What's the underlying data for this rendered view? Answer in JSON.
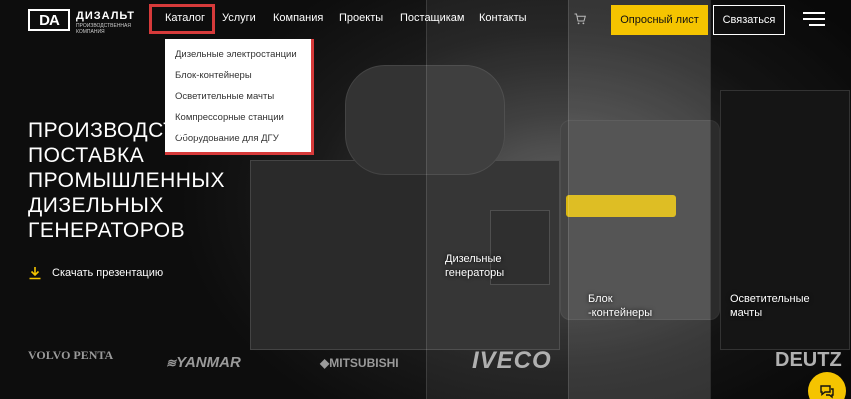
{
  "header": {
    "logo_mark": "DA",
    "logo_name": "ДИЗАЛЬТ",
    "logo_sub": "ПРОИЗВОДСТВЕННАЯ КОМПАНИЯ",
    "nav": [
      "Каталог",
      "Услуги",
      "Компания",
      "Проекты",
      "Постащикам",
      "Контакты"
    ],
    "survey_button": "Опросный лист",
    "contact_button": "Связаться"
  },
  "dropdown": {
    "items": [
      "Дизельные электростанции",
      "Блок-контейнеры",
      "Осветительные мачты",
      "Компрессорные станции",
      "Оборудование для ДГУ"
    ]
  },
  "hero": {
    "title": "Производство и поставка промышленных дизельных генераторов",
    "download_label": "Скачать презентацию"
  },
  "panels": {
    "gen": "Дизельные генераторы",
    "block": "Блок -контейнеры",
    "light": "Осветительные мачты"
  },
  "brands": [
    "VOLVO PENTA",
    "YANMAR",
    "MITSUBISHI",
    "IVECO",
    "DEUTZ"
  ],
  "colors": {
    "accent": "#f5c400",
    "highlight": "#d63a3a",
    "bg": "#0d0d0d"
  }
}
